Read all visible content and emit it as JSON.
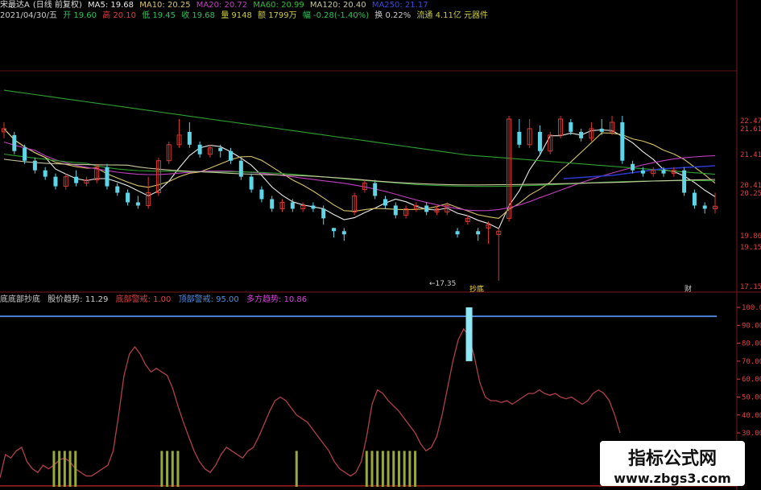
{
  "header": {
    "stock_name": "宋最达A",
    "period_label": "(日线 前复权)",
    "ma5": "MA5: 19.68",
    "ma10": "MA10: 20.25",
    "ma20": "MA20: 20.72",
    "ma60": "MA60: 20.99",
    "ma120": "MA120: 20.40",
    "ma250": "MA250: 21.17",
    "date": "2021/04/30/五",
    "open": "开 19.60",
    "high": "高 20.10",
    "low": "低 19.45",
    "close": "收 19.68",
    "volume": "量 9148",
    "amount": "额 1799万",
    "change": "幅 -0.28(-1.40%)",
    "turnover": "换 0.22%",
    "float_cap": "流通 4.11亿 元器件"
  },
  "indicator": {
    "name": "底底部抄底",
    "trend": "股价趋势: 11.29",
    "bottom_warn": "底部警戒: 1.00",
    "top_warn": "顶部警戒: 95.00",
    "bull_trend": "多方趋势: 10.86"
  },
  "watermark": {
    "line1": "指标公式网",
    "line2": "www.zbgs3.com"
  },
  "colors": {
    "up": "#d9382e",
    "down": "#5ed6e8",
    "ma5": "#e8e8e8",
    "ma10": "#d8c36a",
    "ma20": "#c040c0",
    "ma60": "#30a030",
    "ma120": "#c9c9a0",
    "ma250": "#2a3bd0",
    "line": "#b0404a",
    "warn": "#4a82d8",
    "signal": "#9aa83a"
  },
  "chart_data": {
    "type": "candlestick",
    "price_axis_ticks": [
      "22.47",
      "21.61",
      "21.41",
      "20.41",
      "20.25",
      "19.86",
      "19.15",
      "17.15"
    ],
    "annotations": [
      "17.35",
      "抄底",
      "财"
    ],
    "candles": [
      {
        "o": 22.0,
        "c": 22.1,
        "h": 22.3,
        "l": 21.8
      },
      {
        "o": 21.9,
        "c": 21.4,
        "h": 22.0,
        "l": 21.3
      },
      {
        "o": 21.5,
        "c": 21.1,
        "h": 21.6,
        "l": 21.0
      },
      {
        "o": 21.1,
        "c": 20.8,
        "h": 21.2,
        "l": 20.7
      },
      {
        "o": 20.8,
        "c": 20.6,
        "h": 20.9,
        "l": 20.5
      },
      {
        "o": 20.6,
        "c": 20.3,
        "h": 20.7,
        "l": 20.2
      },
      {
        "o": 20.3,
        "c": 20.6,
        "h": 20.7,
        "l": 20.2
      },
      {
        "o": 20.6,
        "c": 20.4,
        "h": 20.8,
        "l": 20.3
      },
      {
        "o": 20.4,
        "c": 20.5,
        "h": 20.6,
        "l": 20.3
      },
      {
        "o": 20.5,
        "c": 20.9,
        "h": 21.0,
        "l": 20.4
      },
      {
        "o": 20.9,
        "c": 20.3,
        "h": 21.0,
        "l": 20.2
      },
      {
        "o": 20.3,
        "c": 20.1,
        "h": 20.4,
        "l": 20.0
      },
      {
        "o": 20.1,
        "c": 19.8,
        "h": 20.2,
        "l": 19.7
      },
      {
        "o": 19.8,
        "c": 19.7,
        "h": 20.0,
        "l": 19.6
      },
      {
        "o": 19.7,
        "c": 20.1,
        "h": 20.6,
        "l": 19.6
      },
      {
        "o": 20.1,
        "c": 21.1,
        "h": 21.2,
        "l": 20.0
      },
      {
        "o": 21.1,
        "c": 21.6,
        "h": 21.7,
        "l": 21.0
      },
      {
        "o": 21.6,
        "c": 21.9,
        "h": 22.4,
        "l": 21.5
      },
      {
        "o": 22.0,
        "c": 21.6,
        "h": 22.3,
        "l": 21.5
      },
      {
        "o": 21.6,
        "c": 21.3,
        "h": 21.7,
        "l": 21.2
      },
      {
        "o": 21.3,
        "c": 21.5,
        "h": 21.6,
        "l": 21.2
      },
      {
        "o": 21.5,
        "c": 21.4,
        "h": 21.6,
        "l": 21.2
      },
      {
        "o": 21.4,
        "c": 21.1,
        "h": 21.5,
        "l": 21.0
      },
      {
        "o": 21.1,
        "c": 20.6,
        "h": 21.2,
        "l": 20.5
      },
      {
        "o": 20.6,
        "c": 20.2,
        "h": 20.7,
        "l": 20.1
      },
      {
        "o": 20.2,
        "c": 19.9,
        "h": 20.3,
        "l": 19.8
      },
      {
        "o": 19.9,
        "c": 19.6,
        "h": 20.0,
        "l": 19.5
      },
      {
        "o": 19.6,
        "c": 19.8,
        "h": 19.9,
        "l": 19.5
      },
      {
        "o": 19.8,
        "c": 19.6,
        "h": 19.9,
        "l": 19.5
      },
      {
        "o": 19.6,
        "c": 19.7,
        "h": 19.8,
        "l": 19.5
      },
      {
        "o": 19.7,
        "c": 19.6,
        "h": 19.8,
        "l": 19.5
      },
      {
        "o": 19.6,
        "c": 19.3,
        "h": 19.7,
        "l": 19.1
      },
      {
        "o": 19.0,
        "c": 18.9,
        "h": 19.0,
        "l": 18.7
      },
      {
        "o": 18.9,
        "c": 18.8,
        "h": 19.0,
        "l": 18.6
      },
      {
        "o": 19.5,
        "c": 20.0,
        "h": 20.1,
        "l": 19.4
      },
      {
        "o": 20.2,
        "c": 20.4,
        "h": 20.5,
        "l": 20.1
      },
      {
        "o": 20.4,
        "c": 20.0,
        "h": 20.5,
        "l": 19.9
      },
      {
        "o": 19.9,
        "c": 19.7,
        "h": 20.0,
        "l": 19.6
      },
      {
        "o": 19.7,
        "c": 19.4,
        "h": 19.8,
        "l": 19.3
      },
      {
        "o": 19.4,
        "c": 19.6,
        "h": 19.7,
        "l": 19.3
      },
      {
        "o": 19.6,
        "c": 19.7,
        "h": 19.8,
        "l": 19.5
      },
      {
        "o": 19.7,
        "c": 19.5,
        "h": 19.8,
        "l": 19.4
      },
      {
        "o": 19.5,
        "c": 19.6,
        "h": 19.7,
        "l": 19.4
      },
      {
        "o": 19.5,
        "c": 19.7,
        "h": 19.8,
        "l": 19.4
      },
      {
        "o": 18.9,
        "c": 18.8,
        "h": 19.0,
        "l": 18.7
      },
      {
        "o": 19.2,
        "c": 19.3,
        "h": 19.4,
        "l": 19.1
      },
      {
        "o": 18.9,
        "c": 18.8,
        "h": 19.0,
        "l": 18.6
      },
      {
        "o": 19.0,
        "c": 19.1,
        "h": 19.2,
        "l": 18.5
      },
      {
        "o": 18.8,
        "c": 18.9,
        "h": 19.0,
        "l": 17.35
      },
      {
        "o": 19.3,
        "c": 22.4,
        "h": 22.5,
        "l": 19.2
      },
      {
        "o": 22.0,
        "c": 21.6,
        "h": 22.4,
        "l": 21.5
      },
      {
        "o": 21.6,
        "c": 22.1,
        "h": 22.4,
        "l": 21.5
      },
      {
        "o": 22.0,
        "c": 21.4,
        "h": 22.2,
        "l": 21.3
      },
      {
        "o": 21.4,
        "c": 21.9,
        "h": 22.0,
        "l": 21.3
      },
      {
        "o": 21.9,
        "c": 22.4,
        "h": 22.5,
        "l": 21.8
      },
      {
        "o": 22.3,
        "c": 22.0,
        "h": 22.4,
        "l": 21.9
      },
      {
        "o": 22.0,
        "c": 21.8,
        "h": 22.1,
        "l": 21.7
      },
      {
        "o": 21.8,
        "c": 22.1,
        "h": 22.3,
        "l": 21.7
      },
      {
        "o": 22.1,
        "c": 22.0,
        "h": 22.4,
        "l": 21.9
      },
      {
        "o": 22.0,
        "c": 22.3,
        "h": 22.5,
        "l": 21.9
      },
      {
        "o": 22.3,
        "c": 21.1,
        "h": 22.5,
        "l": 21.0
      },
      {
        "o": 21.0,
        "c": 20.8,
        "h": 21.1,
        "l": 20.7
      },
      {
        "o": 20.8,
        "c": 20.7,
        "h": 20.9,
        "l": 20.6
      },
      {
        "o": 20.7,
        "c": 20.8,
        "h": 20.9,
        "l": 20.6
      },
      {
        "o": 20.8,
        "c": 20.7,
        "h": 20.9,
        "l": 20.6
      },
      {
        "o": 20.7,
        "c": 20.8,
        "h": 20.9,
        "l": 20.6
      },
      {
        "o": 20.8,
        "c": 20.1,
        "h": 20.9,
        "l": 20.0
      },
      {
        "o": 20.1,
        "c": 19.7,
        "h": 20.2,
        "l": 19.6
      },
      {
        "o": 19.7,
        "c": 19.6,
        "h": 19.8,
        "l": 19.45
      },
      {
        "o": 19.6,
        "c": 19.68,
        "h": 20.1,
        "l": 19.45
      }
    ],
    "ind_line": [
      5,
      18,
      16,
      20,
      22,
      14,
      10,
      8,
      12,
      10,
      12,
      15,
      16,
      14,
      10,
      8,
      6,
      6,
      8,
      10,
      12,
      20,
      40,
      62,
      74,
      78,
      74,
      68,
      64,
      66,
      64,
      62,
      55,
      45,
      36,
      28,
      20,
      14,
      10,
      8,
      12,
      18,
      22,
      20,
      18,
      16,
      20,
      22,
      28,
      35,
      42,
      48,
      50,
      48,
      44,
      40,
      38,
      36,
      32,
      28,
      24,
      20,
      14,
      10,
      8,
      6,
      8,
      14,
      28,
      46,
      54,
      52,
      48,
      45,
      42,
      38,
      34,
      30,
      24,
      20,
      22,
      28,
      40,
      55,
      70,
      82,
      88,
      84,
      72,
      58,
      50,
      48,
      48,
      47,
      48,
      46,
      48,
      50,
      52,
      52,
      54,
      52,
      51,
      52,
      50,
      49,
      50,
      48,
      46,
      48,
      52,
      54,
      52,
      48,
      40,
      30
    ],
    "bottom_signals": [
      10,
      11,
      12,
      13,
      14,
      30,
      31,
      32,
      33,
      55,
      68,
      69,
      70,
      71,
      72,
      73,
      74,
      75,
      76,
      77
    ],
    "top_signal": 87,
    "warn_level": 95
  }
}
